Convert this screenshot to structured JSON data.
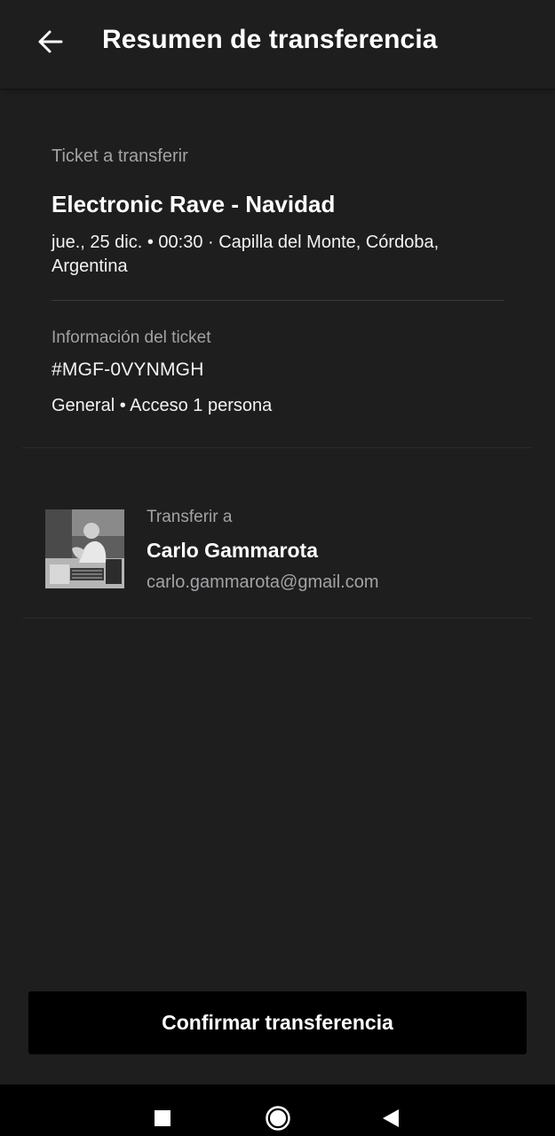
{
  "header": {
    "title": "Resumen de transferencia",
    "back_icon": "arrow-left-icon"
  },
  "ticket": {
    "section_label": "Ticket a transferir",
    "event_title": "Electronic Rave - Navidad",
    "event_details": "jue., 25 dic. • 00:30 · Capilla del Monte, Córdoba, Argentina",
    "info_label": "Información del ticket",
    "code": "#MGF-0VYNMGH",
    "type": "General • Acceso 1 persona"
  },
  "recipient": {
    "label": "Transferir a",
    "name": "Carlo Gammarota",
    "email": "carlo.gammarota@gmail.com"
  },
  "actions": {
    "confirm_label": "Confirmar transferencia"
  },
  "nav": {
    "recent_icon": "square-icon",
    "home_icon": "circle-icon",
    "back_icon": "triangle-back-icon"
  },
  "colors": {
    "background": "#1e1e1f",
    "muted_text": "#a3a3a6",
    "button_bg": "#000000"
  }
}
